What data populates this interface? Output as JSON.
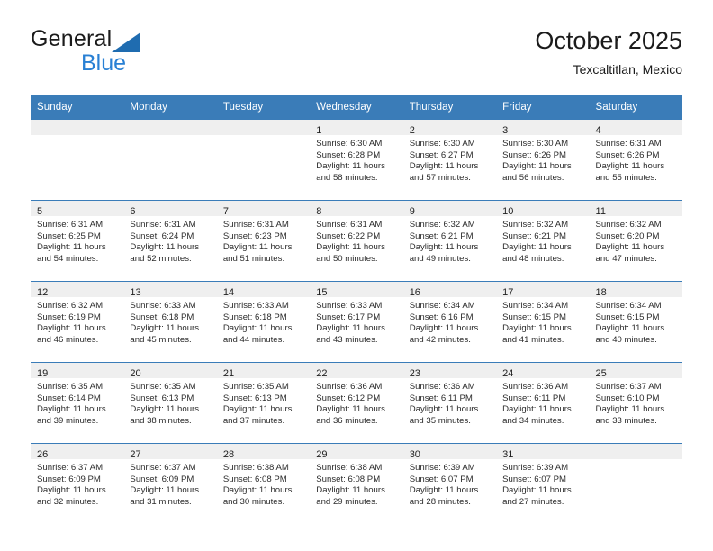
{
  "brand": {
    "name_top": "General",
    "name_bottom": "Blue",
    "triangle_color": "#1f6cb0",
    "blue_text_color": "#2980d4"
  },
  "header": {
    "title": "October 2025",
    "subtitle": "Texcaltitlan, Mexico"
  },
  "theme": {
    "header_blue": "#3a7cb8",
    "daynum_band": "#efefef",
    "cell_bg": "#ffffff",
    "text": "#222222"
  },
  "calendar": {
    "weekday_headers": [
      "Sunday",
      "Monday",
      "Tuesday",
      "Wednesday",
      "Thursday",
      "Friday",
      "Saturday"
    ],
    "weeks": [
      [
        {
          "day": "",
          "sunrise": "",
          "sunset": "",
          "daylight1": "",
          "daylight2": ""
        },
        {
          "day": "",
          "sunrise": "",
          "sunset": "",
          "daylight1": "",
          "daylight2": ""
        },
        {
          "day": "",
          "sunrise": "",
          "sunset": "",
          "daylight1": "",
          "daylight2": ""
        },
        {
          "day": "1",
          "sunrise": "Sunrise: 6:30 AM",
          "sunset": "Sunset: 6:28 PM",
          "daylight1": "Daylight: 11 hours",
          "daylight2": "and 58 minutes."
        },
        {
          "day": "2",
          "sunrise": "Sunrise: 6:30 AM",
          "sunset": "Sunset: 6:27 PM",
          "daylight1": "Daylight: 11 hours",
          "daylight2": "and 57 minutes."
        },
        {
          "day": "3",
          "sunrise": "Sunrise: 6:30 AM",
          "sunset": "Sunset: 6:26 PM",
          "daylight1": "Daylight: 11 hours",
          "daylight2": "and 56 minutes."
        },
        {
          "day": "4",
          "sunrise": "Sunrise: 6:31 AM",
          "sunset": "Sunset: 6:26 PM",
          "daylight1": "Daylight: 11 hours",
          "daylight2": "and 55 minutes."
        }
      ],
      [
        {
          "day": "5",
          "sunrise": "Sunrise: 6:31 AM",
          "sunset": "Sunset: 6:25 PM",
          "daylight1": "Daylight: 11 hours",
          "daylight2": "and 54 minutes."
        },
        {
          "day": "6",
          "sunrise": "Sunrise: 6:31 AM",
          "sunset": "Sunset: 6:24 PM",
          "daylight1": "Daylight: 11 hours",
          "daylight2": "and 52 minutes."
        },
        {
          "day": "7",
          "sunrise": "Sunrise: 6:31 AM",
          "sunset": "Sunset: 6:23 PM",
          "daylight1": "Daylight: 11 hours",
          "daylight2": "and 51 minutes."
        },
        {
          "day": "8",
          "sunrise": "Sunrise: 6:31 AM",
          "sunset": "Sunset: 6:22 PM",
          "daylight1": "Daylight: 11 hours",
          "daylight2": "and 50 minutes."
        },
        {
          "day": "9",
          "sunrise": "Sunrise: 6:32 AM",
          "sunset": "Sunset: 6:21 PM",
          "daylight1": "Daylight: 11 hours",
          "daylight2": "and 49 minutes."
        },
        {
          "day": "10",
          "sunrise": "Sunrise: 6:32 AM",
          "sunset": "Sunset: 6:21 PM",
          "daylight1": "Daylight: 11 hours",
          "daylight2": "and 48 minutes."
        },
        {
          "day": "11",
          "sunrise": "Sunrise: 6:32 AM",
          "sunset": "Sunset: 6:20 PM",
          "daylight1": "Daylight: 11 hours",
          "daylight2": "and 47 minutes."
        }
      ],
      [
        {
          "day": "12",
          "sunrise": "Sunrise: 6:32 AM",
          "sunset": "Sunset: 6:19 PM",
          "daylight1": "Daylight: 11 hours",
          "daylight2": "and 46 minutes."
        },
        {
          "day": "13",
          "sunrise": "Sunrise: 6:33 AM",
          "sunset": "Sunset: 6:18 PM",
          "daylight1": "Daylight: 11 hours",
          "daylight2": "and 45 minutes."
        },
        {
          "day": "14",
          "sunrise": "Sunrise: 6:33 AM",
          "sunset": "Sunset: 6:18 PM",
          "daylight1": "Daylight: 11 hours",
          "daylight2": "and 44 minutes."
        },
        {
          "day": "15",
          "sunrise": "Sunrise: 6:33 AM",
          "sunset": "Sunset: 6:17 PM",
          "daylight1": "Daylight: 11 hours",
          "daylight2": "and 43 minutes."
        },
        {
          "day": "16",
          "sunrise": "Sunrise: 6:34 AM",
          "sunset": "Sunset: 6:16 PM",
          "daylight1": "Daylight: 11 hours",
          "daylight2": "and 42 minutes."
        },
        {
          "day": "17",
          "sunrise": "Sunrise: 6:34 AM",
          "sunset": "Sunset: 6:15 PM",
          "daylight1": "Daylight: 11 hours",
          "daylight2": "and 41 minutes."
        },
        {
          "day": "18",
          "sunrise": "Sunrise: 6:34 AM",
          "sunset": "Sunset: 6:15 PM",
          "daylight1": "Daylight: 11 hours",
          "daylight2": "and 40 minutes."
        }
      ],
      [
        {
          "day": "19",
          "sunrise": "Sunrise: 6:35 AM",
          "sunset": "Sunset: 6:14 PM",
          "daylight1": "Daylight: 11 hours",
          "daylight2": "and 39 minutes."
        },
        {
          "day": "20",
          "sunrise": "Sunrise: 6:35 AM",
          "sunset": "Sunset: 6:13 PM",
          "daylight1": "Daylight: 11 hours",
          "daylight2": "and 38 minutes."
        },
        {
          "day": "21",
          "sunrise": "Sunrise: 6:35 AM",
          "sunset": "Sunset: 6:13 PM",
          "daylight1": "Daylight: 11 hours",
          "daylight2": "and 37 minutes."
        },
        {
          "day": "22",
          "sunrise": "Sunrise: 6:36 AM",
          "sunset": "Sunset: 6:12 PM",
          "daylight1": "Daylight: 11 hours",
          "daylight2": "and 36 minutes."
        },
        {
          "day": "23",
          "sunrise": "Sunrise: 6:36 AM",
          "sunset": "Sunset: 6:11 PM",
          "daylight1": "Daylight: 11 hours",
          "daylight2": "and 35 minutes."
        },
        {
          "day": "24",
          "sunrise": "Sunrise: 6:36 AM",
          "sunset": "Sunset: 6:11 PM",
          "daylight1": "Daylight: 11 hours",
          "daylight2": "and 34 minutes."
        },
        {
          "day": "25",
          "sunrise": "Sunrise: 6:37 AM",
          "sunset": "Sunset: 6:10 PM",
          "daylight1": "Daylight: 11 hours",
          "daylight2": "and 33 minutes."
        }
      ],
      [
        {
          "day": "26",
          "sunrise": "Sunrise: 6:37 AM",
          "sunset": "Sunset: 6:09 PM",
          "daylight1": "Daylight: 11 hours",
          "daylight2": "and 32 minutes."
        },
        {
          "day": "27",
          "sunrise": "Sunrise: 6:37 AM",
          "sunset": "Sunset: 6:09 PM",
          "daylight1": "Daylight: 11 hours",
          "daylight2": "and 31 minutes."
        },
        {
          "day": "28",
          "sunrise": "Sunrise: 6:38 AM",
          "sunset": "Sunset: 6:08 PM",
          "daylight1": "Daylight: 11 hours",
          "daylight2": "and 30 minutes."
        },
        {
          "day": "29",
          "sunrise": "Sunrise: 6:38 AM",
          "sunset": "Sunset: 6:08 PM",
          "daylight1": "Daylight: 11 hours",
          "daylight2": "and 29 minutes."
        },
        {
          "day": "30",
          "sunrise": "Sunrise: 6:39 AM",
          "sunset": "Sunset: 6:07 PM",
          "daylight1": "Daylight: 11 hours",
          "daylight2": "and 28 minutes."
        },
        {
          "day": "31",
          "sunrise": "Sunrise: 6:39 AM",
          "sunset": "Sunset: 6:07 PM",
          "daylight1": "Daylight: 11 hours",
          "daylight2": "and 27 minutes."
        },
        {
          "day": "",
          "sunrise": "",
          "sunset": "",
          "daylight1": "",
          "daylight2": ""
        }
      ]
    ]
  }
}
